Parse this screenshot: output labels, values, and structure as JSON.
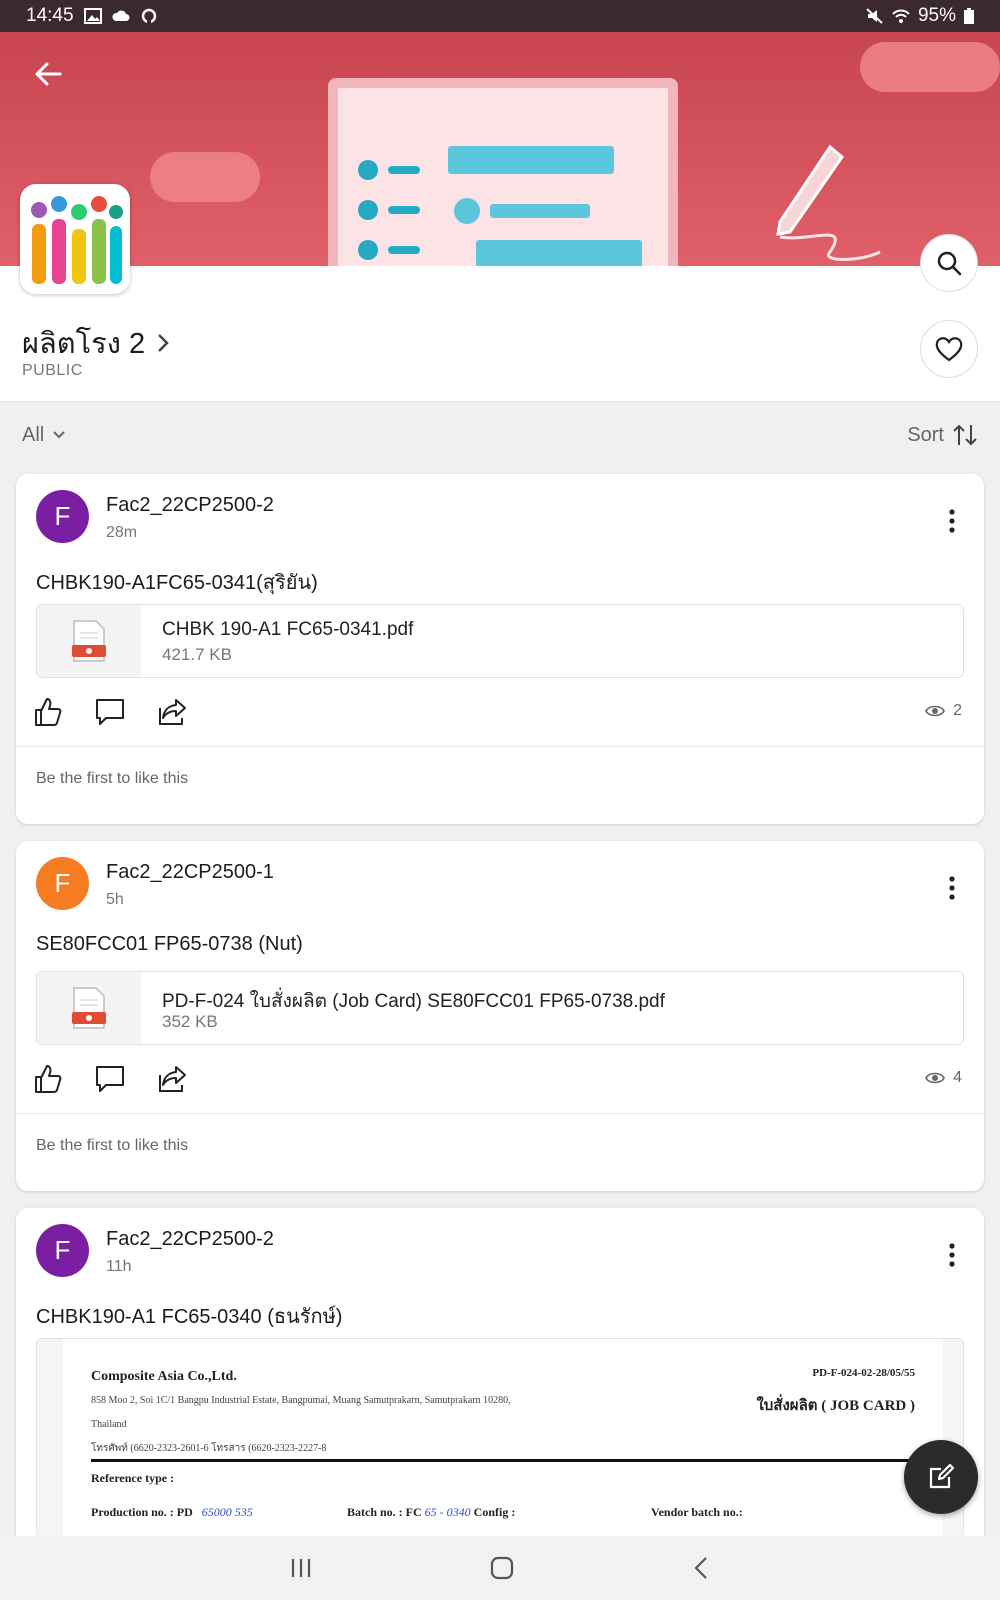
{
  "status_bar": {
    "time": "14:45",
    "battery": "95%",
    "icons": [
      "gallery-icon",
      "cloud-icon",
      "sync-icon",
      "mute-icon",
      "wifi-icon",
      "battery-icon"
    ]
  },
  "group": {
    "name": "ผลิตโรง 2",
    "visibility": "PUBLIC"
  },
  "filter": {
    "all_label": "All",
    "sort_label": "Sort"
  },
  "posts": [
    {
      "avatar_letter": "F",
      "avatar_color": "#7b1fa2",
      "author": "Fac2_22CP2500-2",
      "time": "28m",
      "text": "CHBK190-A1FC65-0341(สุริยัน)",
      "file_name": "CHBK 190-A1 FC65-0341.pdf",
      "file_size": "421.7 KB",
      "views": "2",
      "likes_text": "Be the first to like this"
    },
    {
      "avatar_letter": "F",
      "avatar_color": "#f57c20",
      "author": "Fac2_22CP2500-1",
      "time": "5h",
      "text": "SE80FCC01 FP65-0738 (Nut)",
      "file_name": "PD-F-024 ใบสั่งผลิต (Job Card) SE80FCC01 FP65-0738.pdf",
      "file_size": "352 KB",
      "views": "4",
      "likes_text": "Be the first to like this"
    },
    {
      "avatar_letter": "F",
      "avatar_color": "#7b1fa2",
      "author": "Fac2_22CP2500-2",
      "time": "11h",
      "text": "CHBK190-A1 FC65-0340 (ธนรักษ์)",
      "document": {
        "company": "Composite Asia Co.,Ltd.",
        "address": "858 Moo 2, Soi 1C/1 Bangpu Industrial Estate, Bangpumai, Muang Samutprakarn, Samutprakarn 10280,",
        "country": "Thailand",
        "phone": "โทรศัพท์ (6620-2323-2601-6 โทรสาร (6620-2323-2227-8",
        "form_code": "PD-F-024-02-28/05/55",
        "form_title": "ใบสั่งผลิต ( JOB CARD )",
        "reference_label": "Reference type :",
        "production_label": "Production no. : PD",
        "production_value": "65000 535",
        "batch_label": "Batch no. : FC",
        "batch_value": "65 - 0340",
        "config_label": "Config :",
        "vendor_label": "Vendor batch no.:"
      }
    }
  ]
}
